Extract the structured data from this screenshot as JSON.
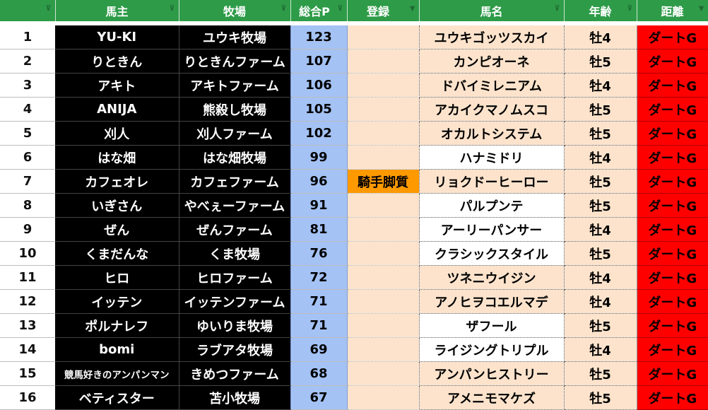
{
  "headers": {
    "owner": "馬主",
    "ranch": "牧場",
    "points": "総合P",
    "register": "登録",
    "horse": "馬名",
    "age": "年齢",
    "distance": "距離"
  },
  "filter_glyph": "⊽",
  "active_filter_glyph": "▼",
  "rows": [
    {
      "num": "1",
      "owner": "YU-KI",
      "ranch": "ユウキ牧場",
      "points": "123",
      "register": "",
      "horse": "ユウキゴッツスカイ",
      "age": "牡4",
      "distance": "ダートG"
    },
    {
      "num": "2",
      "owner": "りときん",
      "ranch": "りときんファーム",
      "points": "107",
      "register": "",
      "horse": "カンピオーネ",
      "age": "牡5",
      "distance": "ダートG"
    },
    {
      "num": "3",
      "owner": "アキト",
      "ranch": "アキトファーム",
      "points": "106",
      "register": "",
      "horse": "ドバイミレニアム",
      "age": "牡4",
      "distance": "ダートG"
    },
    {
      "num": "4",
      "owner": "ANIJA",
      "ranch": "熊殺し牧場",
      "points": "105",
      "register": "",
      "horse": "アカイクマノムスコ",
      "age": "牡5",
      "distance": "ダートG"
    },
    {
      "num": "5",
      "owner": "刈人",
      "ranch": "刈人ファーム",
      "points": "102",
      "register": "",
      "horse": "オカルトシステム",
      "age": "牡5",
      "distance": "ダートG"
    },
    {
      "num": "6",
      "owner": "はな畑",
      "ranch": "はな畑牧場",
      "points": "99",
      "register": "",
      "horse": "ハナミドリ",
      "age": "牡4",
      "distance": "ダートG"
    },
    {
      "num": "7",
      "owner": "カフェオレ",
      "ranch": "カフェファーム",
      "points": "96",
      "register": "騎手脚質",
      "horse": "リョクドーヒーロー",
      "age": "牡5",
      "distance": "ダートG"
    },
    {
      "num": "8",
      "owner": "いぎさん",
      "ranch": "やべぇーファーム",
      "points": "91",
      "register": "",
      "horse": "パルプンテ",
      "age": "牡5",
      "distance": "ダートG"
    },
    {
      "num": "9",
      "owner": "ぜん",
      "ranch": "ぜんファーム",
      "points": "81",
      "register": "",
      "horse": "アーリーパンサー",
      "age": "牡4",
      "distance": "ダートG"
    },
    {
      "num": "10",
      "owner": "くまだんな",
      "ranch": "くま牧場",
      "points": "76",
      "register": "",
      "horse": "クラシックスタイル",
      "age": "牡5",
      "distance": "ダートG"
    },
    {
      "num": "11",
      "owner": "ヒロ",
      "ranch": "ヒロファーム",
      "points": "72",
      "register": "",
      "horse": "ツネニウイジン",
      "age": "牡4",
      "distance": "ダートG"
    },
    {
      "num": "12",
      "owner": "イッテン",
      "ranch": "イッテンファーム",
      "points": "71",
      "register": "",
      "horse": "アノヒヲコエルマデ",
      "age": "牡4",
      "distance": "ダートG"
    },
    {
      "num": "13",
      "owner": "ポルナレフ",
      "ranch": "ゆいりま牧場",
      "points": "71",
      "register": "",
      "horse": "ザフール",
      "age": "牡5",
      "distance": "ダートG"
    },
    {
      "num": "14",
      "owner": "bomi",
      "ranch": "ラブアタ牧場",
      "points": "69",
      "register": "",
      "horse": "ライジングトリプル",
      "age": "牡4",
      "distance": "ダートG"
    },
    {
      "num": "15",
      "owner": "競馬好きのアンパンマン",
      "ranch": "きめつファーム",
      "points": "68",
      "register": "",
      "horse": "アンパンヒストリー",
      "age": "牡5",
      "distance": "ダートG"
    },
    {
      "num": "16",
      "owner": "ベティスター",
      "ranch": "苫小牧場",
      "points": "67",
      "register": "",
      "horse": "アメニモマケズ",
      "age": "牡5",
      "distance": "ダートG"
    }
  ],
  "colors": {
    "header_green": "#2e9b48",
    "owner_black": "#000000",
    "points_blue": "#a4c2f4",
    "peach": "#fde3cc",
    "tag_orange": "#ff9900",
    "distance_red": "#ff0000"
  }
}
